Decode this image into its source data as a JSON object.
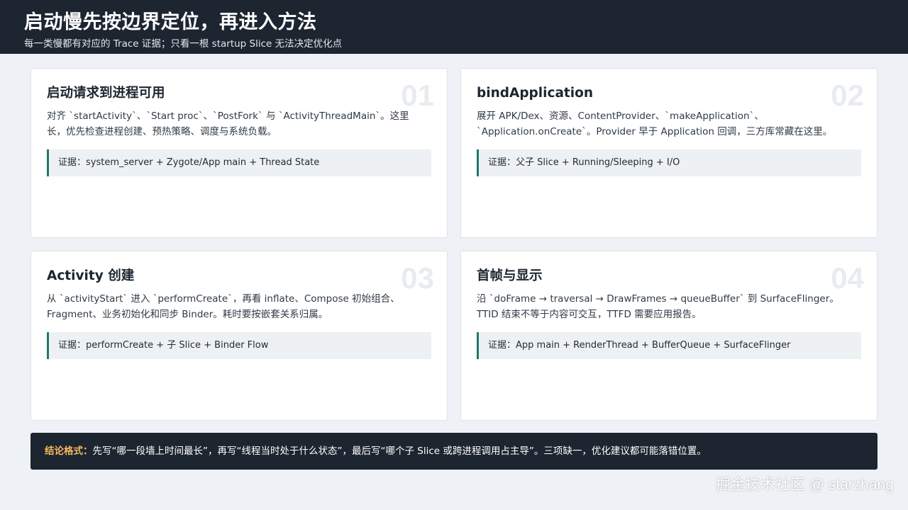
{
  "header": {
    "title": "启动慢先按边界定位，再进入方法",
    "subtitle": "每一类慢都有对应的 Trace 证据；只看一根 startup Slice 无法决定优化点"
  },
  "cards": [
    {
      "number": "01",
      "title": "启动请求到进程可用",
      "description": "对齐 `startActivity`、`Start proc`、`PostFork` 与 `ActivityThreadMain`。这里长，优先检查进程创建、预热策略、调度与系统负载。",
      "evidence": "证据：system_server + Zygote/App main + Thread State"
    },
    {
      "number": "02",
      "title": "bindApplication",
      "description": "展开 APK/Dex、资源、ContentProvider、`makeApplication`、`Application.onCreate`。Provider 早于 Application 回调，三方库常藏在这里。",
      "evidence": "证据：父子 Slice + Running/Sleeping + I/O"
    },
    {
      "number": "03",
      "title": "Activity 创建",
      "description": "从 `activityStart` 进入 `performCreate`，再看 inflate、Compose 初始组合、Fragment、业务初始化和同步 Binder。耗时要按嵌套关系归属。",
      "evidence": "证据：performCreate + 子 Slice + Binder Flow"
    },
    {
      "number": "04",
      "title": "首帧与显示",
      "description": "沿 `doFrame → traversal → DrawFrames → queueBuffer` 到 SurfaceFlinger。TTID 结束不等于内容可交互，TTFD 需要应用报告。",
      "evidence": "证据：App main + RenderThread + BufferQueue + SurfaceFlinger"
    }
  ],
  "conclusion": {
    "label": "结论格式：",
    "text": "先写“哪一段墙上时间最长”，再写“线程当时处于什么状态”，最后写“哪个子 Slice 或跨进程调用占主导”。三项缺一，优化建议都可能落错位置。"
  },
  "watermark": "掘金技术社区 @ starzhang",
  "colors": {
    "header_bg": "#1c2530",
    "accent_teal": "#1d7a6b",
    "label_orange": "#f5b85b",
    "page_bg": "#eef1f5"
  }
}
